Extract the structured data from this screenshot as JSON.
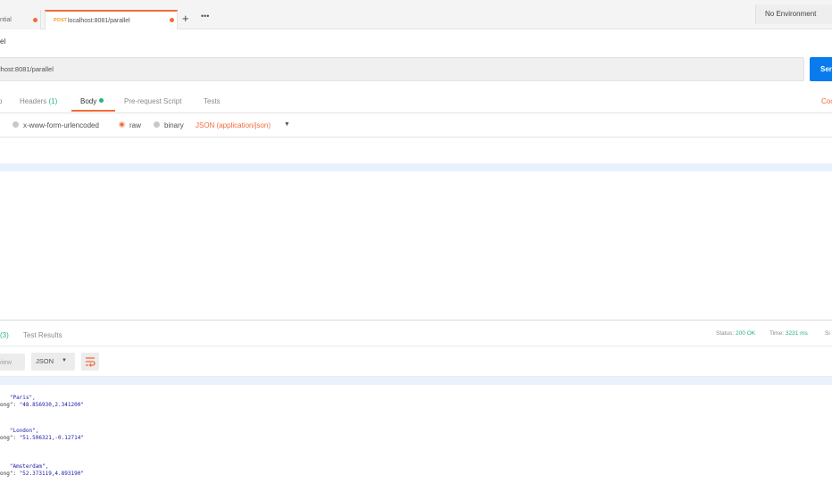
{
  "tabs": [
    {
      "label": "ntial"
    },
    {
      "method": "POST",
      "label": "localhost:8081/parallel"
    }
  ],
  "tab_actions": {
    "add": "+",
    "more": "•••"
  },
  "environment": {
    "label": "No Environment"
  },
  "request": {
    "name": "el",
    "url": "lhost:8081/parallel",
    "send_label": "Ser"
  },
  "request_tabs": {
    "left_partial": "o",
    "headers": "Headers",
    "headers_count": "(1)",
    "body": "Body",
    "prerequest": "Pre-request Script",
    "tests": "Tests",
    "code": "Coo"
  },
  "body_options": {
    "urlencoded": "x-www-form-urlencoded",
    "raw": "raw",
    "binary": "binary",
    "content_type": "JSON (application/json)",
    "caret": "▼"
  },
  "response": {
    "tabs": {
      "headers_count": "(3)",
      "test_results": "Test Results"
    },
    "status_label": "Status:",
    "status_value": "200 OK",
    "time_label": "Time:",
    "time_value": "3231 ms",
    "size_partial": "Si",
    "preview_label": "view",
    "format": "JSON",
    "format_caret": "▼"
  },
  "response_body": [
    {
      "key": "\"Paris\",",
      "line2_key": "ong\": ",
      "line2_val": "\"48.856930,2.341200\""
    },
    {
      "key": "\"London\",",
      "line2_key": "ong\": ",
      "line2_val": "\"51.506321,-0.12714\""
    },
    {
      "key": "\"Amsterdam\",",
      "line2_key": "ong\": ",
      "line2_val": "\"52.373119,4.893190\""
    }
  ],
  "colors": {
    "accent": "#f26b3a",
    "send": "#097bed",
    "success": "#26b47f",
    "string": "#1a1aa6"
  }
}
